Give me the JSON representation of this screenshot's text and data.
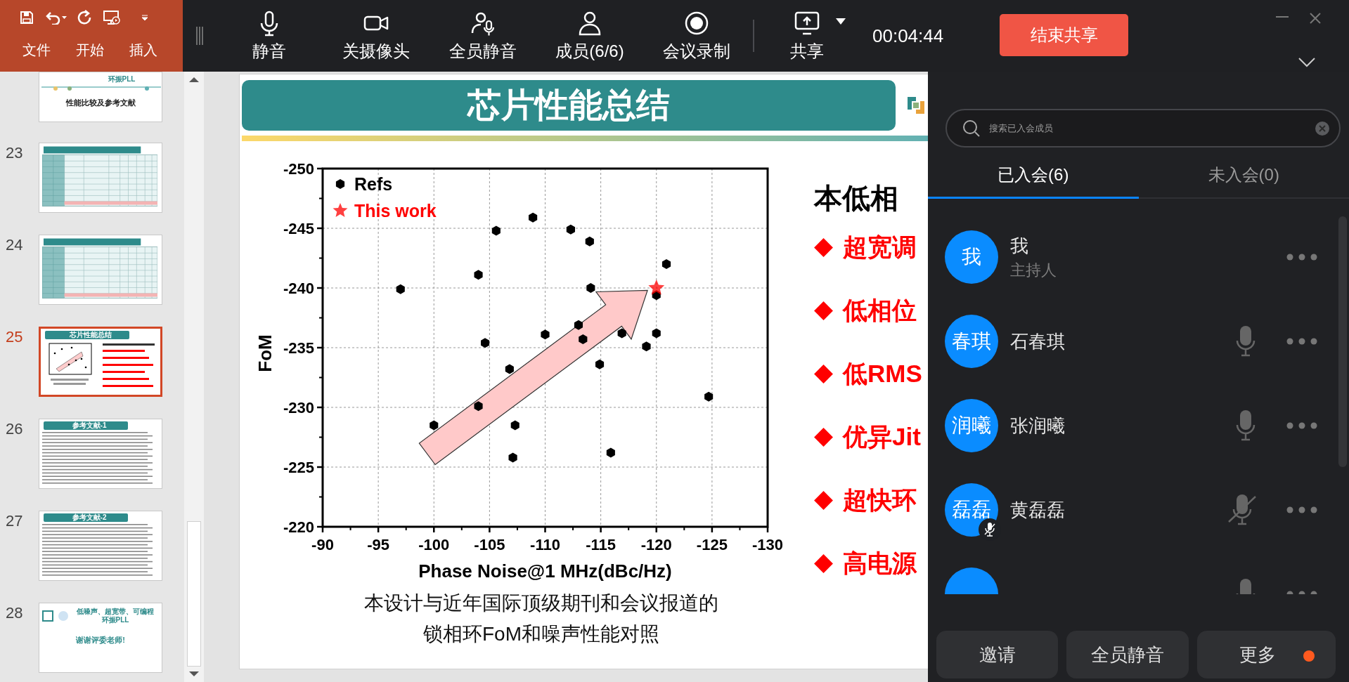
{
  "ribbon": {
    "tabs": [
      "文件",
      "开始",
      "插入"
    ]
  },
  "toolbar": {
    "items": [
      {
        "label": "静音"
      },
      {
        "label": "关摄像头"
      },
      {
        "label": "全员静音"
      },
      {
        "label": "成员(6/6)"
      },
      {
        "label": "会议录制"
      }
    ],
    "share": {
      "label": "共享"
    },
    "timer": "00:04:44",
    "end_share_button": "结束共享"
  },
  "slides_pane": {
    "slides": [
      {
        "kind": "cover_partial",
        "selected": false,
        "lines": [
          "环振PLL",
          "性能比较及参考文献"
        ]
      },
      {
        "number": "23",
        "kind": "table",
        "selected": false
      },
      {
        "number": "24",
        "kind": "table",
        "selected": false
      },
      {
        "number": "25",
        "kind": "summary",
        "selected": true,
        "title": "芯片性能总结"
      },
      {
        "number": "26",
        "kind": "references",
        "selected": false,
        "title": "参考文献-1"
      },
      {
        "number": "27",
        "kind": "references",
        "selected": false,
        "title": "参考文献-2"
      },
      {
        "number": "28",
        "kind": "closing",
        "selected": false,
        "lines": [
          "低噪声、超宽带、可编程",
          "环振PLL",
          "谢谢评委老师!"
        ]
      }
    ]
  },
  "slide": {
    "title": "芯片性能总结",
    "chart_data": {
      "type": "scatter",
      "xlabel": "Phase Noise@1 MHz(dBc/Hz)",
      "ylabel": "FoM",
      "xlim": [
        -90,
        -130
      ],
      "ylim": [
        -220,
        -250
      ],
      "xticks": [
        -90,
        -95,
        -100,
        -105,
        -110,
        -115,
        -120,
        -125,
        -130
      ],
      "yticks": [
        -220,
        -225,
        -230,
        -235,
        -240,
        -245,
        -250
      ],
      "series": [
        {
          "name": "Refs",
          "color": "#000000",
          "x": [
            -97,
            -104,
            -105.6,
            -108.9,
            -112.3,
            -114,
            -120.9,
            -114.1,
            -120,
            -113,
            -113.4,
            -110,
            -116.9,
            -120,
            -104.6,
            -119.1,
            -114.9,
            -106.8,
            -104,
            -100,
            -107.3,
            -107.1,
            -115.9,
            -124.7
          ],
          "values": [
            -239.9,
            -241.1,
            -244.8,
            -245.9,
            -244.9,
            -243.9,
            -242,
            -240,
            -239.4,
            -236.9,
            -235.7,
            -236.1,
            -236.2,
            -236.2,
            -235.4,
            -235.1,
            -233.6,
            -233.2,
            -230.1,
            -228.5,
            -228.5,
            -225.8,
            -226.2,
            -230.9
          ]
        },
        {
          "name": "This work",
          "color": "#ff0000",
          "x": [
            -120
          ],
          "values": [
            -240
          ]
        }
      ],
      "grid": true,
      "legend": true
    },
    "caption": [
      "本设计与近年国际顶级期刊和会议报道的",
      "锁相环FoM和噪声性能对照"
    ],
    "heading": "本低相",
    "bullets": [
      "超宽调",
      "低相位",
      "低RMS",
      "优异Jit",
      "超快环",
      "高电源"
    ]
  },
  "panel": {
    "search": {
      "placeholder": "搜索已入会成员"
    },
    "tabs": [
      {
        "label": "已入会(6)",
        "selected": true
      },
      {
        "label": "未入会(0)",
        "selected": false
      }
    ],
    "members": [
      {
        "kind": "host",
        "avatar": "我",
        "name": "我",
        "role": "主持人",
        "muted_badge": false
      },
      {
        "kind": "participant",
        "avatar": "春琪",
        "name": "石春琪",
        "mic_muted": false,
        "muted_badge": false
      },
      {
        "kind": "participant",
        "avatar": "润曦",
        "name": "张润曦",
        "mic_muted": false,
        "muted_badge": false
      },
      {
        "kind": "participant",
        "avatar": "磊磊",
        "name": "黄磊磊",
        "mic_muted": true,
        "muted_badge": true
      },
      {
        "kind": "partial",
        "mic_muted": false
      }
    ],
    "buttons": [
      {
        "label": "邀请",
        "notification_dot": false
      },
      {
        "label": "全员静音",
        "notification_dot": false
      },
      {
        "label": "更多",
        "notification_dot": true
      }
    ]
  }
}
